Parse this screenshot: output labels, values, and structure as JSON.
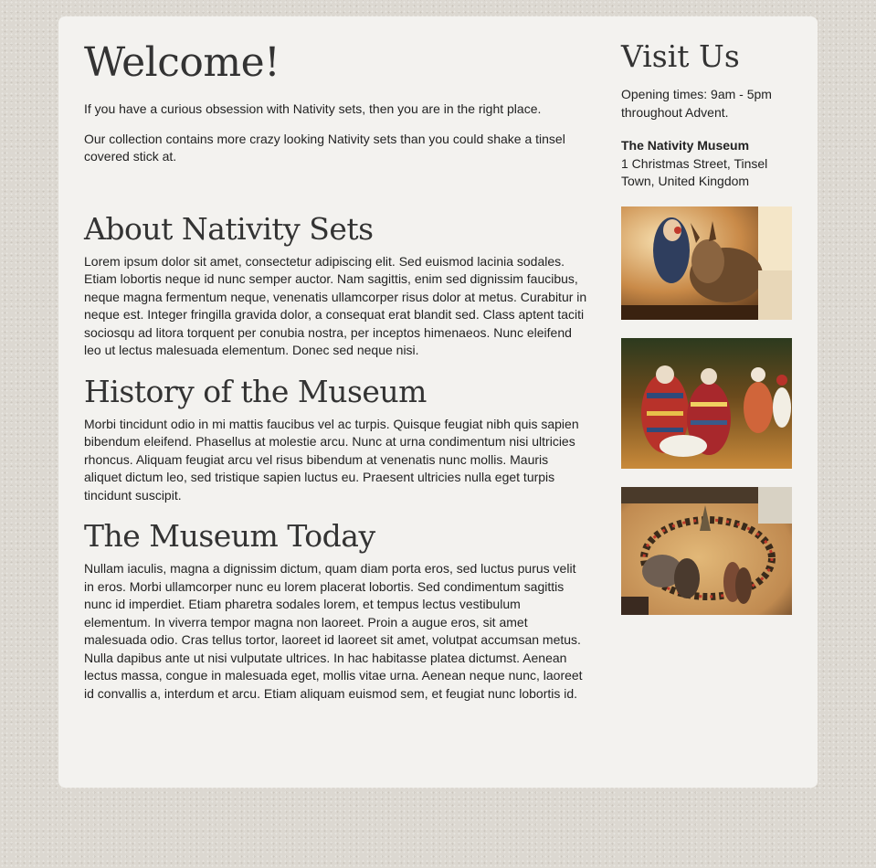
{
  "main": {
    "welcome_title": "Welcome!",
    "intro_1": "If you have a curious obsession with Nativity sets, then you are in the right place.",
    "intro_2": "Our collection contains more crazy looking Nativity sets than you could shake a tinsel covered stick at.",
    "sections": [
      {
        "title": "About Nativity Sets",
        "body": "Lorem ipsum dolor sit amet, consectetur adipiscing elit. Sed euismod lacinia sodales. Etiam lobortis neque id nunc semper auctor. Nam sagittis, enim sed dignissim faucibus, neque magna fermentum neque, venenatis ullamcorper risus dolor at metus. Curabitur in neque est. Integer fringilla gravida dolor, a consequat erat blandit sed. Class aptent taciti sociosqu ad litora torquent per conubia nostra, per inceptos himenaeos. Nunc eleifend leo ut lectus malesuada elementum. Donec sed neque nisi."
      },
      {
        "title": "History of the Museum",
        "body": "Morbi tincidunt odio in mi mattis faucibus vel ac turpis. Quisque feugiat nibh quis sapien bibendum eleifend. Phasellus at molestie arcu. Nunc at urna condimentum nisi ultricies rhoncus. Aliquam feugiat arcu vel risus bibendum at venenatis nunc mollis. Mauris aliquet dictum leo, sed tristique sapien luctus eu. Praesent ultricies nulla eget turpis tincidunt suscipit."
      },
      {
        "title": "The Museum Today",
        "body": "Nullam iaculis, magna a dignissim dictum, quam diam porta eros, sed luctus purus velit in eros. Morbi ullamcorper nunc eu lorem placerat lobortis. Sed condimentum sagittis nunc id imperdiet. Etiam pharetra sodales lorem, et tempus lectus vestibulum elementum. In viverra tempor magna non laoreet. Proin a augue eros, sit amet malesuada odio. Cras tellus tortor, laoreet id laoreet sit amet, volutpat accumsan metus. Nulla dapibus ante ut nisi vulputate ultrices. In hac habitasse platea dictumst. Aenean lectus massa, congue in malesuada eget, mollis vitae urna. Aenean neque nunc, laoreet id convallis a, interdum et arcu. Etiam aliquam euismod sem, et feugiat nunc lobortis id."
      }
    ]
  },
  "sidebar": {
    "title": "Visit Us",
    "opening_times": "Opening times: 9am - 5pm throughout Advent.",
    "address_name": "The Nativity Museum",
    "address_line": "1 Christmas Street, Tinsel Town, United Kingdom",
    "photos": [
      "nativity-donkey-photo",
      "nativity-knitted-figures-photo",
      "nativity-collection-circle-photo"
    ]
  },
  "colors": {
    "background": "#dcd8d1",
    "panel": "#f3f2ef",
    "heading": "#333333",
    "text": "#222222"
  }
}
